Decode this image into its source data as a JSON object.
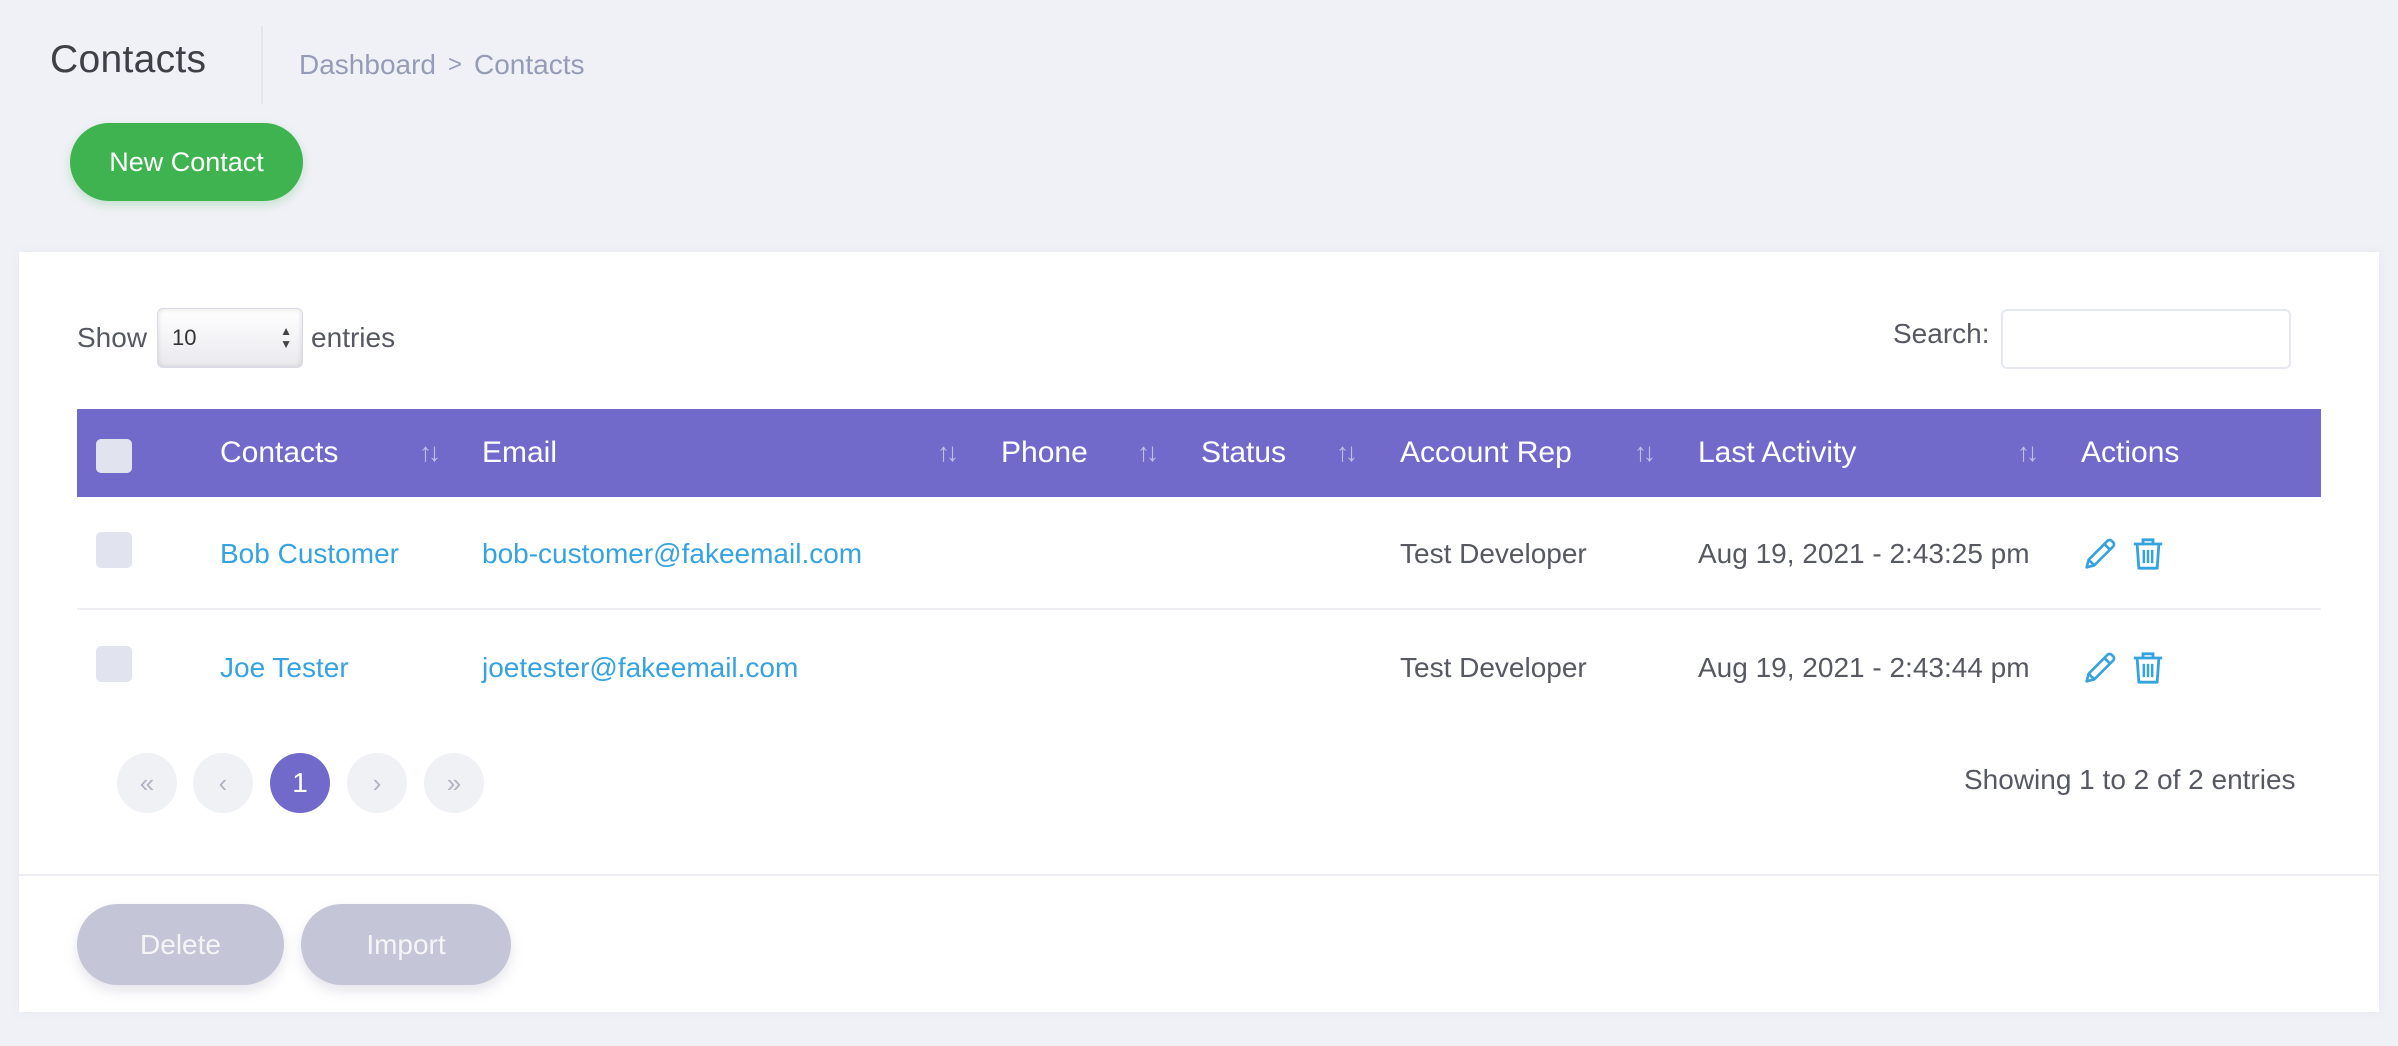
{
  "page": {
    "title": "Contacts",
    "breadcrumb": [
      "Dashboard",
      "Contacts"
    ],
    "breadcrumb_separator": ">"
  },
  "actions": {
    "new_contact": "New Contact"
  },
  "table_controls": {
    "show_label": "Show",
    "entries_per_page": "10",
    "entries_label": "entries",
    "search_label": "Search:",
    "search_value": ""
  },
  "columns": [
    "Contacts",
    "Email",
    "Phone",
    "Status",
    "Account Rep",
    "Last Activity",
    "Actions"
  ],
  "rows": [
    {
      "name": "Bob Customer",
      "email": "bob-customer@fakeemail.com",
      "phone": "",
      "status": "",
      "account_rep": "Test Developer",
      "last_activity": "Aug 19, 2021 - 2:43:25 pm"
    },
    {
      "name": "Joe Tester",
      "email": "joetester@fakeemail.com",
      "phone": "",
      "status": "",
      "account_rep": "Test Developer",
      "last_activity": "Aug 19, 2021 - 2:43:44 pm"
    }
  ],
  "pagination": {
    "current_page": "1",
    "info": "Showing 1 to 2 of 2 entries",
    "controls": [
      "first-page-icon",
      "previous-page-icon",
      "next-page-icon",
      "last-page-icon"
    ]
  },
  "bulk_actions": {
    "delete": "Delete",
    "import": "Import"
  },
  "colors": {
    "accent": "#716aca",
    "success": "#3fb34f",
    "link": "#36a3e0",
    "muted_button": "#c4c5d6",
    "background": "#f0f1f7"
  },
  "icons": {
    "sort": "sort-arrows-icon",
    "edit": "pencil-icon",
    "delete": "trash-icon"
  }
}
